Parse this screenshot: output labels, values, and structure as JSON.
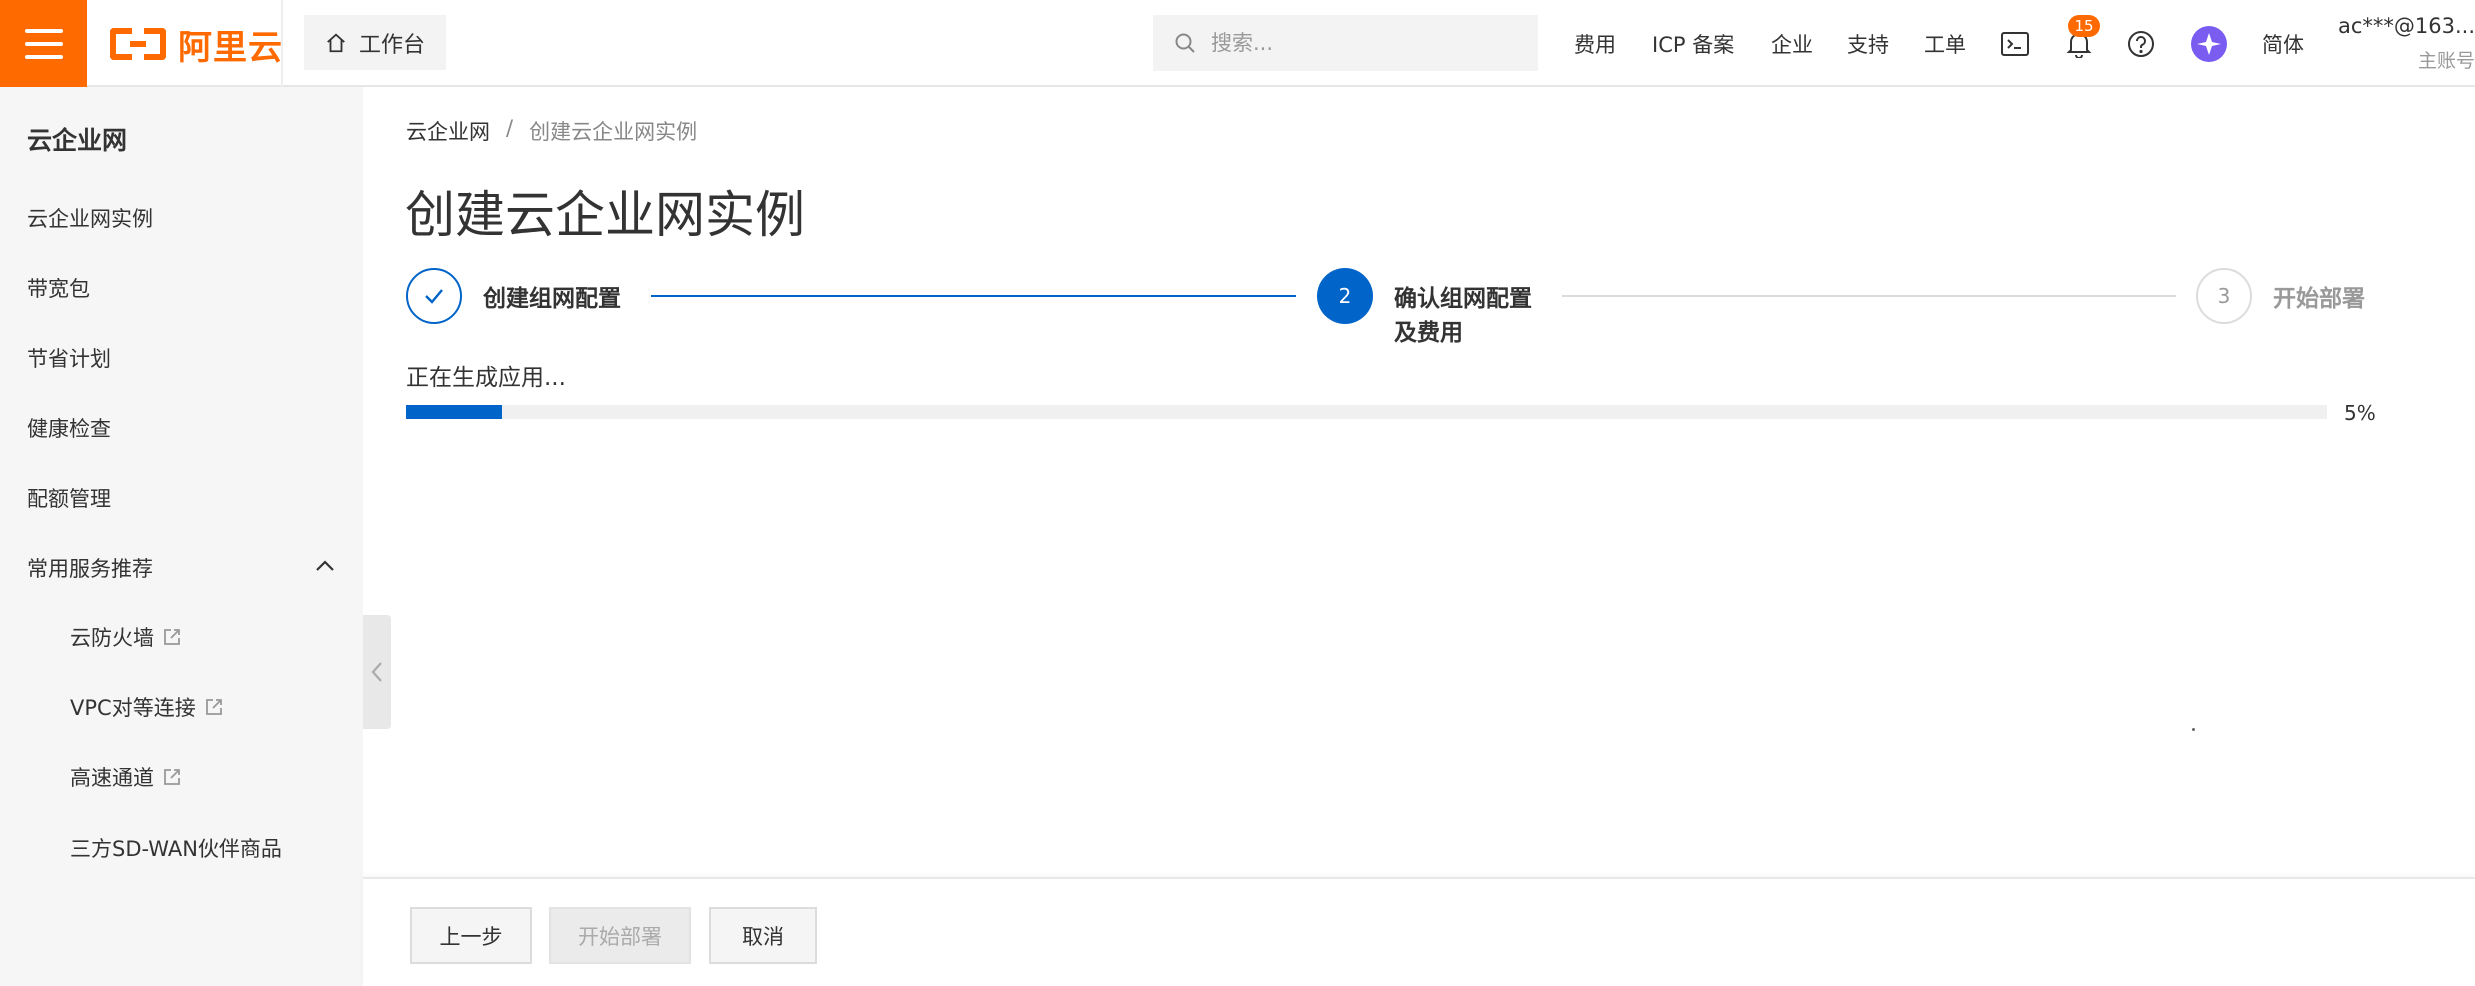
{
  "header": {
    "brand": "阿里云",
    "workbench_label": "工作台",
    "search_placeholder": "搜索...",
    "nav": [
      "费用",
      "ICP 备案",
      "企业",
      "支持",
      "工单"
    ],
    "notification_count": "15",
    "language": "简体",
    "account_name": "ac***@163....",
    "account_type": "主账号"
  },
  "sidebar": {
    "title": "云企业网",
    "items": [
      "云企业网实例",
      "带宽包",
      "节省计划",
      "健康检查",
      "配额管理",
      "常用服务推荐"
    ],
    "sub_items": [
      "云防火墙",
      "VPC对等连接",
      "高速通道",
      "三方SD-WAN伙伴商品"
    ]
  },
  "breadcrumb": {
    "root": "云企业网",
    "separator": "/",
    "current": "创建云企业网实例"
  },
  "page_title": "创建云企业网实例",
  "steps": [
    {
      "number": "1",
      "label": "创建组网配置",
      "status": "done"
    },
    {
      "number": "2",
      "label_line1": "确认组网配置",
      "label_line2": "及费用",
      "status": "active"
    },
    {
      "number": "3",
      "label": "开始部署",
      "status": "wait"
    }
  ],
  "progress": {
    "text": "正在生成应用...",
    "percent_label": "5%",
    "value": 5
  },
  "footer": {
    "prev": "上一步",
    "deploy": "开始部署",
    "cancel": "取消"
  },
  "colors": {
    "brand_orange": "#ff6a00",
    "primary_blue": "#0064c8"
  }
}
